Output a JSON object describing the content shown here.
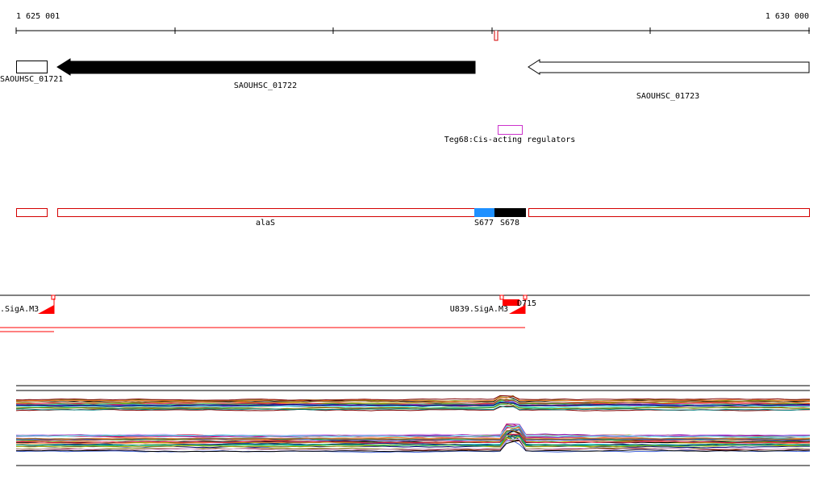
{
  "ruler": {
    "start_label": "1 625 001",
    "end_label": "1 630 000"
  },
  "genes": [
    {
      "name": "SAOUHSC_01721"
    },
    {
      "name": "SAOUHSC_01722"
    },
    {
      "name": "SAOUHSC_01723"
    }
  ],
  "regulators": [
    {
      "label": "Teg68:Cis-acting regulators",
      "color": "#cc33cc"
    }
  ],
  "segments": [
    {
      "label": "alaS"
    },
    {
      "label": "S677",
      "color": "#1e90ff"
    },
    {
      "label": "S678",
      "color": "#000000"
    }
  ],
  "promoters": [
    {
      "label": ".SigA.M3"
    },
    {
      "label": "U839.SigA.M3"
    },
    {
      "label": "D715"
    }
  ],
  "colors": {
    "segment_outline": "#d40000",
    "promoter_red": "#ff0000",
    "gene_filled": "#000000",
    "gene_outline": "#000000",
    "expression_line_colors": [
      "#e6194b",
      "#3cb44b",
      "#808000",
      "#4363d8",
      "#f58231",
      "#911eb4",
      "#46f0f0",
      "#000075",
      "#9a6324",
      "#800000",
      "#aaaa00",
      "#008080",
      "#000000",
      "#e6beff"
    ]
  }
}
